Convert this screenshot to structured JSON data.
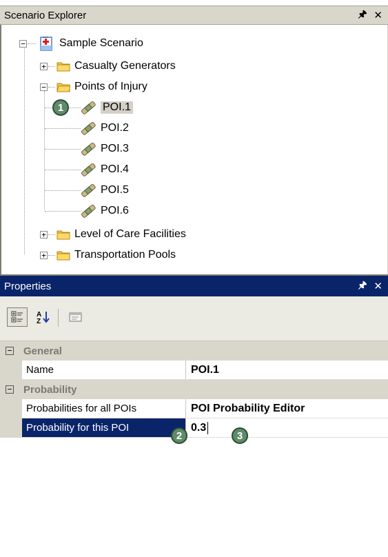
{
  "explorer": {
    "title": "Scenario Explorer",
    "root": {
      "label": "Sample Scenario",
      "icon": "scenario-document-icon"
    },
    "folders": {
      "casualty": "Casualty Generators",
      "poi": "Points of Injury",
      "loc": "Level of Care Facilities",
      "transport": "Transportation Pools"
    },
    "poi_items": [
      "POI.1",
      "POI.2",
      "POI.3",
      "POI.4",
      "POI.5",
      "POI.6"
    ],
    "selected_item": "POI.1"
  },
  "properties": {
    "title": "Properties",
    "toolbar": {
      "categorized": "categorized-icon",
      "alphabetical": "alphabetical-sort-icon",
      "property_pages": "property-pages-icon"
    },
    "categories": {
      "general": "General",
      "probability": "Probability"
    },
    "rows": {
      "name": {
        "label": "Name",
        "value": "POI.1"
      },
      "all_pois": {
        "label": "Probabilities for all POIs",
        "value": "POI Probability Editor"
      },
      "this_poi": {
        "label": "Probability for this POI",
        "value": "0.3"
      }
    }
  },
  "callouts": [
    "1",
    "2",
    "3"
  ],
  "colors": {
    "selection": "#0a246a",
    "badge": "#5e8c6a",
    "folder": "#f5c542",
    "chrome": "#d9d6cc"
  }
}
